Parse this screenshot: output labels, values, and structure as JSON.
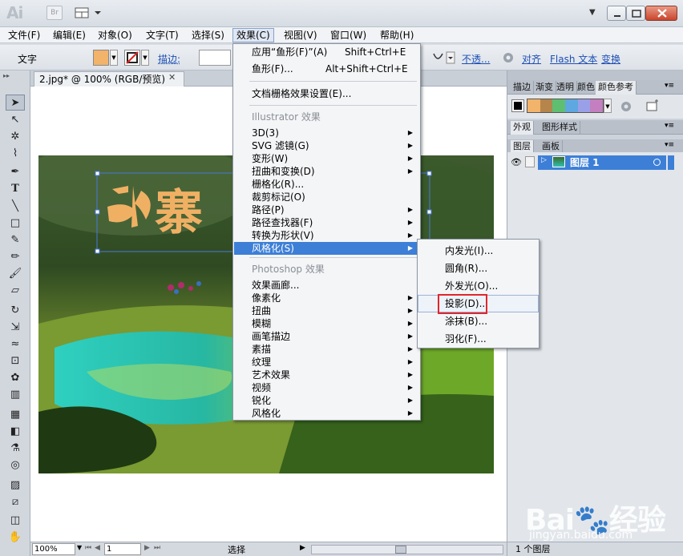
{
  "app": {
    "logo": "Ai",
    "bridge": "Br"
  },
  "menubar": [
    "文件(F)",
    "编辑(E)",
    "对象(O)",
    "文字(T)",
    "选择(S)",
    "效果(C)",
    "视图(V)",
    "窗口(W)",
    "帮助(H)"
  ],
  "controlbar": {
    "label": "文字",
    "stroke_label": "描边:",
    "opacity": "不透...",
    "align": "对齐",
    "flash_text": "Flash 文本",
    "transform": "变换"
  },
  "document": {
    "tab_title": "2.jpg* @ 100% (RGB/预览)",
    "artwork_text": "寨",
    "zoom": "100%",
    "page": "1",
    "status_tool": "选择"
  },
  "panels": {
    "top_tabs": [
      "描边",
      "渐变",
      "透明",
      "颜色",
      "颜色参考"
    ],
    "mid_tabs": [
      "外观",
      "图形样式"
    ],
    "layer_tabs": [
      "图层",
      "画板"
    ],
    "layer_name": "图层 1",
    "layers_status": "1 个图层",
    "swatches": [
      "#f2b36a",
      "#b5854b",
      "#5fbf70",
      "#5ea7e0",
      "#9aa0e8",
      "#c37fc0"
    ]
  },
  "effect_menu": {
    "apply_last": "应用“鱼形(F)”(A)",
    "apply_last_shortcut": "Shift+Ctrl+E",
    "last": "鱼形(F)...",
    "last_shortcut": "Alt+Shift+Ctrl+E",
    "raster_settings": "文档栅格效果设置(E)...",
    "illustrator_header": "Illustrator 效果",
    "illustrator_items": [
      "3D(3)",
      "SVG 滤镜(G)",
      "变形(W)",
      "扭曲和变换(D)",
      "栅格化(R)...",
      "裁剪标记(O)",
      "路径(P)",
      "路径查找器(F)",
      "转换为形状(V)",
      "风格化(S)"
    ],
    "photoshop_header": "Photoshop 效果",
    "photoshop_items": [
      "效果画廊...",
      "像素化",
      "扭曲",
      "模糊",
      "画笔描边",
      "素描",
      "纹理",
      "艺术效果",
      "视频",
      "锐化",
      "风格化"
    ]
  },
  "stylize_submenu": [
    "内发光(I)...",
    "圆角(R)...",
    "外发光(O)...",
    "投影(D)...",
    "涂抹(B)...",
    "羽化(F)..."
  ],
  "watermark": {
    "brand": "Bai🐾经验",
    "url": "jingyan.baidu.com"
  }
}
